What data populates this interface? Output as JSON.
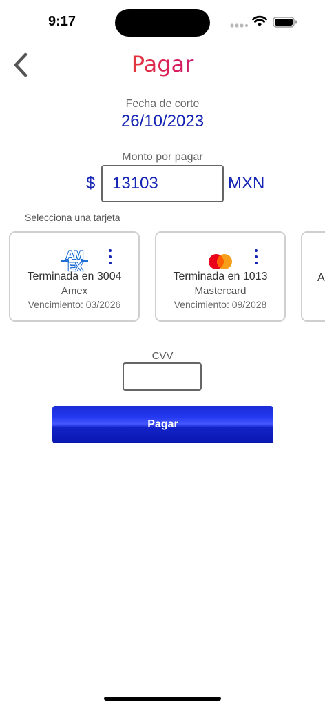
{
  "status_bar": {
    "time": "9:17"
  },
  "header": {
    "back_icon": "chevron-left-icon",
    "title": "Pagar"
  },
  "cutoff": {
    "label": "Fecha de corte",
    "date": "26/10/2023"
  },
  "amount": {
    "label": "Monto por pagar",
    "currency_symbol": "$",
    "value": "13103",
    "currency_code": "MXN"
  },
  "cards_section": {
    "label": "Selecciona una tarjeta",
    "cards": [
      {
        "logo": "amex-logo",
        "logo_text_top": "AM",
        "logo_text_bottom": "EX",
        "ending": "Terminada en 3004",
        "brand": "Amex",
        "expiry": "Vencimiento: 03/2026"
      },
      {
        "logo": "mastercard-logo",
        "ending": "Terminada en 1013",
        "brand": "Mastercard",
        "expiry": "Vencimiento: 09/2028"
      },
      {
        "initial": "A"
      }
    ]
  },
  "cvv": {
    "label": "CVV",
    "value": ""
  },
  "pay_button": {
    "label": "Pagar"
  },
  "colors": {
    "accent_blue": "#1525b3",
    "button_blue": "#0a18b0",
    "border_gray": "#cfcfcf",
    "amex_blue": "#1f6ed4",
    "mastercard_red": "#eb001b",
    "mastercard_orange": "#f79e1b"
  }
}
